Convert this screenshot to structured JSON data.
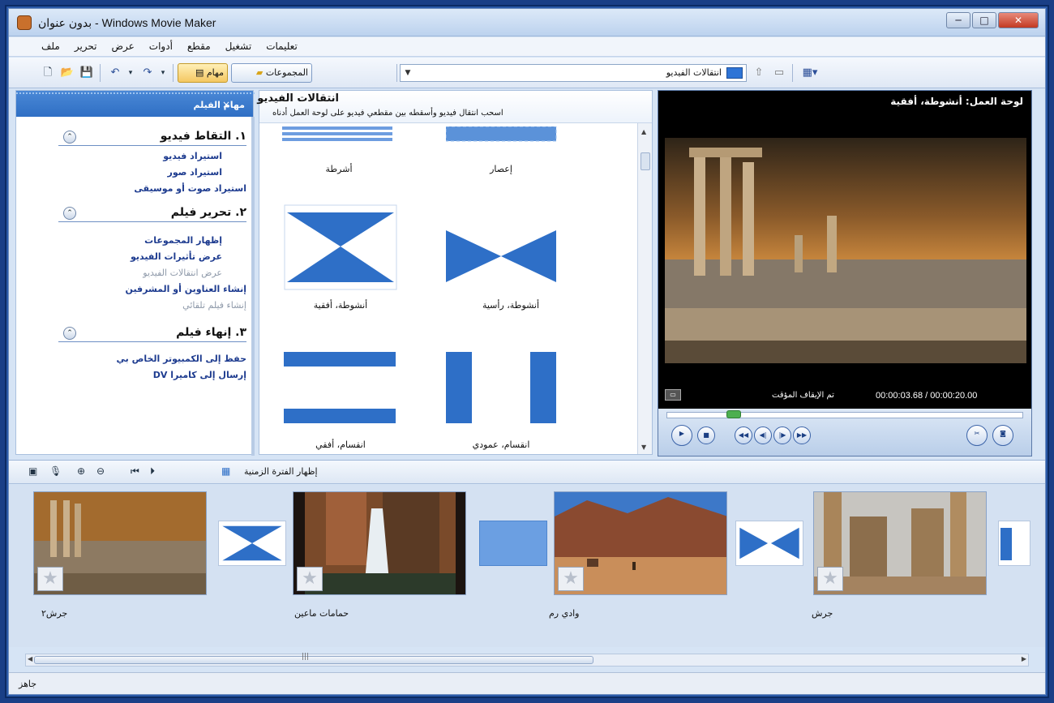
{
  "window": {
    "title": "بدون عنوان - Windows Movie Maker",
    "min": "─",
    "max": "□",
    "close": "✕"
  },
  "menu": [
    "ملف",
    "تحرير",
    "عرض",
    "أدوات",
    "مقطع",
    "تشغيل",
    "تعليمات"
  ],
  "toolbar": {
    "tasks_label": "مهام",
    "collections_label": "المجموعات",
    "combo_value": "انتقالات الفيديو"
  },
  "left_panel": {
    "title": "مهام الفيلم",
    "close": "×",
    "sections": [
      {
        "heading": "١. التقاط فيديو",
        "links": [
          "استيراد فيديو",
          "استيراد صور",
          "استيراد صوت أو موسيقى"
        ]
      },
      {
        "heading": "٢. تحرير فيلم",
        "links": [
          "إظهار المجموعات",
          "عرض تأثيرات الفيديو",
          "عرض انتقالات الفيديو",
          "إنشاء العناوين أو المشرفين",
          "إنشاء فيلم تلقائي"
        ]
      },
      {
        "heading": "٣. إنهاء فيلم",
        "links": [
          "حفظ إلى الكمبيوتر الخاص بي",
          "إرسال إلى كاميرا DV"
        ]
      }
    ],
    "collapse": "⌃"
  },
  "content": {
    "title": "انتقالات الفيديو",
    "subtitle": "اسحب انتقال فيديو وأسقطه بين مقطعي فيديو على لوحة العمل أدناه",
    "tiles": [
      "إعصار",
      "أشرطة",
      "أنشوطة، رأسية",
      "أنشوطة، أفقية",
      "انقسام، عمودي",
      "انقسام، أفقي"
    ]
  },
  "preview": {
    "title": "لوحة العمل: أنشوطة، أفقية",
    "status": "تم الإيقاف المؤقت",
    "time": "00:00:03.68 / 00:00:20.00"
  },
  "timeline": {
    "show_timeline_label": "إظهار الفترة الزمنية"
  },
  "clips": [
    {
      "label": "جرش٢"
    },
    {
      "label": "حمامات ماعين"
    },
    {
      "label": "وادي رم"
    },
    {
      "label": "جرش"
    }
  ],
  "statusbar": {
    "text": "جاهز"
  },
  "colors": {
    "accent": "#2f6fc4",
    "transition_blue": "#2e6fc7",
    "link": "#1d3b8f"
  }
}
